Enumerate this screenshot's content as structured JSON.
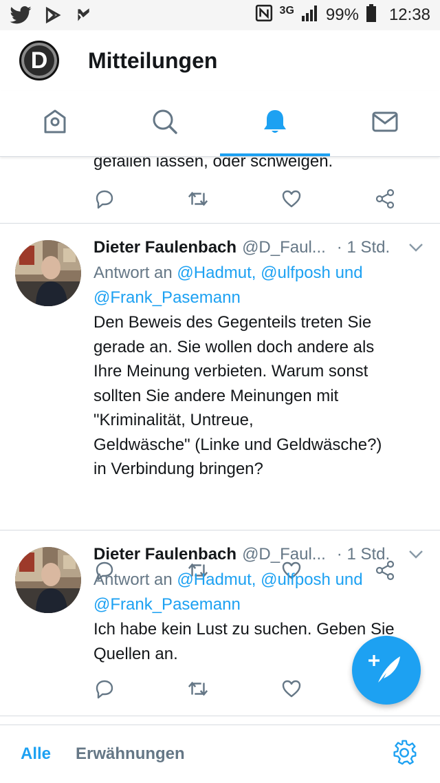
{
  "status_bar": {
    "network": "3G",
    "battery": "99%",
    "time": "12:38"
  },
  "header": {
    "avatar_letter": "D",
    "title": "Mitteilungen"
  },
  "tabs": [
    {
      "icon": "home-icon"
    },
    {
      "icon": "search-icon"
    },
    {
      "icon": "bell-icon",
      "active": true
    },
    {
      "icon": "mail-icon"
    }
  ],
  "feed": {
    "partial_text": "gefallen lassen, oder schweigen.",
    "tweets": [
      {
        "name": "Dieter Faulenbach",
        "handle": "@D_Faul...",
        "time": "· 1 Std.",
        "reply_prefix": "Antwort an ",
        "reply_mentions_line1": "@Hadmut, @ulfposh und",
        "reply_mentions_line2": "@Frank_Pasemann",
        "text": "Den Beweis des Gegenteils treten Sie\ngerade an. Sie wollen doch andere als\nIhre Meinung verbieten. Warum sonst\nsollten Sie andere Meinungen mit\n\"Kriminalität, Untreue,\nGeldwäsche\" (Linke und Geldwäsche?)\nin Verbindung bringen?"
      },
      {
        "name": "Dieter Faulenbach",
        "handle": "@D_Faul...",
        "time": "· 1 Std.",
        "reply_prefix": "Antwort an ",
        "reply_mentions_line1": "@Hadmut, @ulfposh und",
        "reply_mentions_line2": "@Frank_Pasemann",
        "text": "Ich habe kein Lust zu suchen.  Geben Sie\nQuellen an."
      }
    ]
  },
  "bottom_bar": {
    "all_label": "Alle",
    "mentions_label": "Erwähnungen"
  },
  "colors": {
    "accent": "#1da1f2",
    "text": "#14171a",
    "secondary": "#657786",
    "icon": "#657786"
  }
}
